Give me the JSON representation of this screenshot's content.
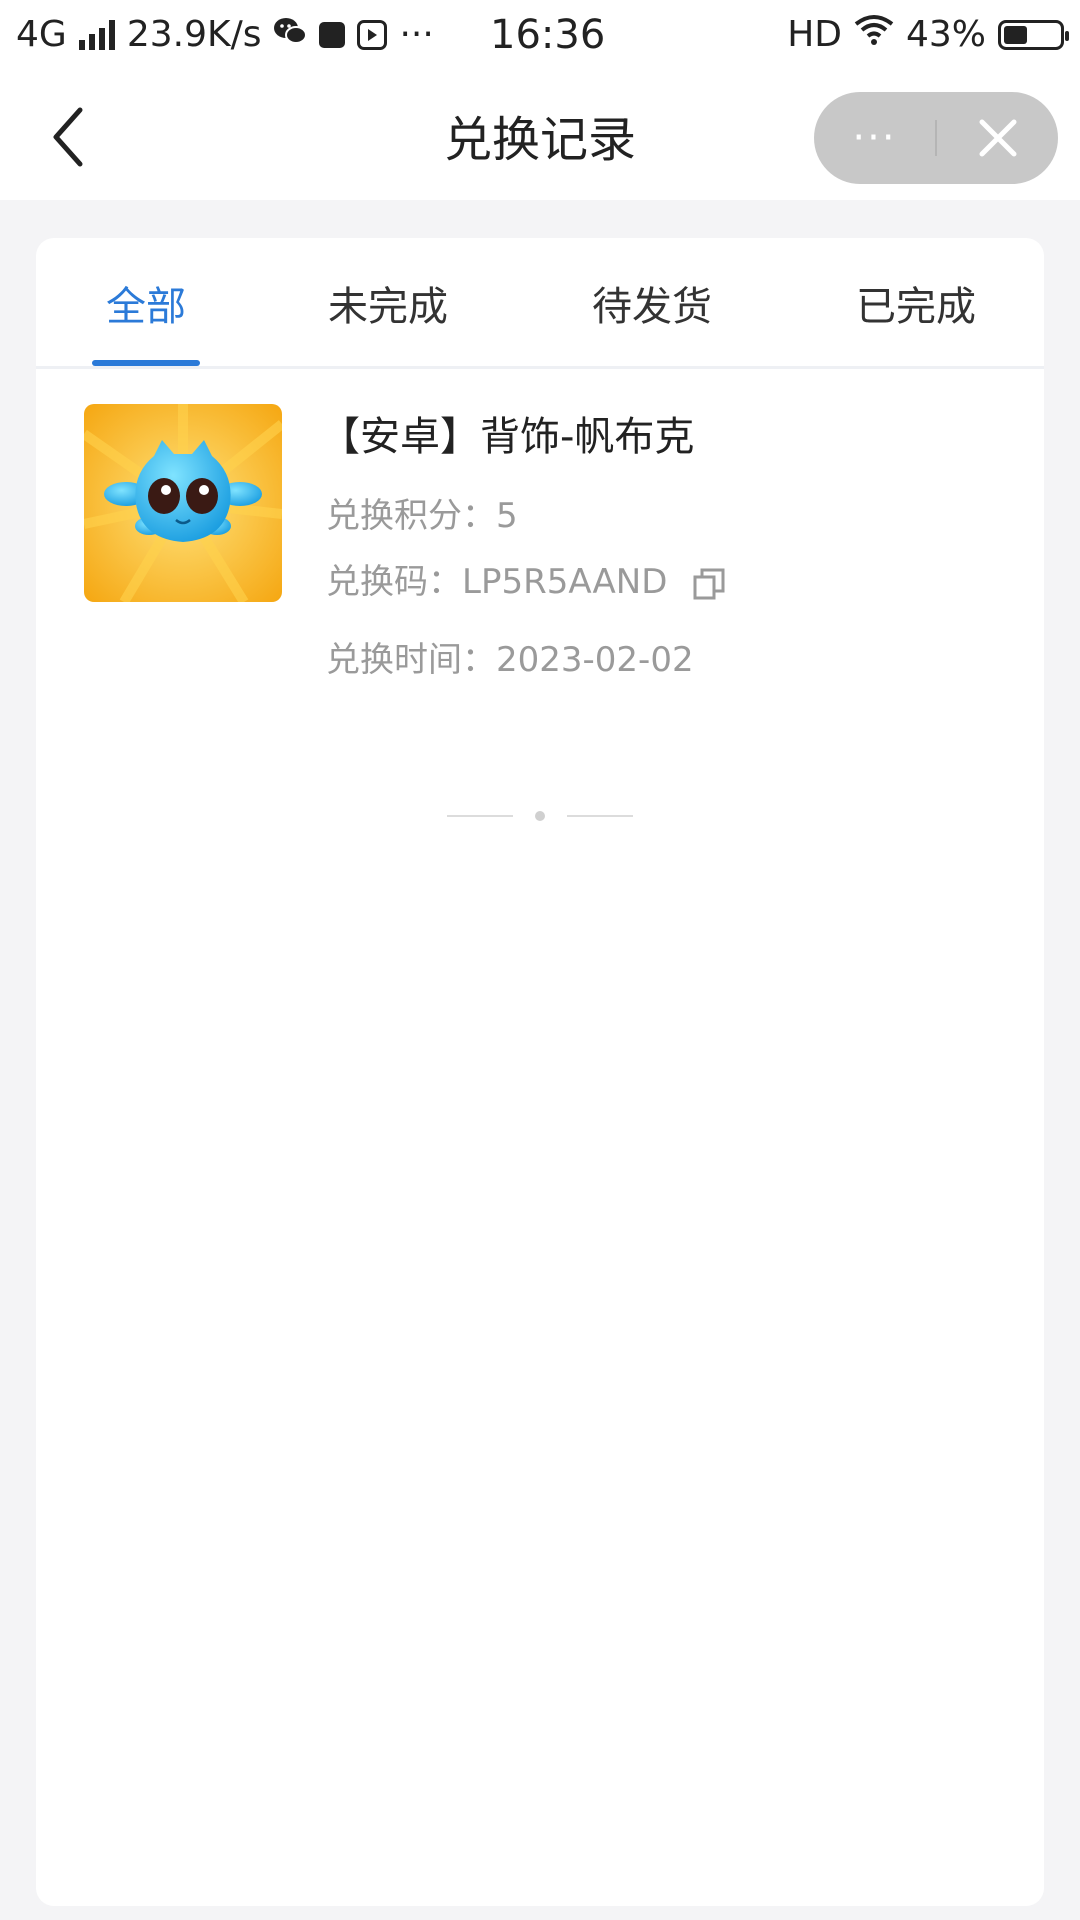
{
  "status_bar": {
    "network": "4G",
    "speed": "23.9K/s",
    "more": "···",
    "time": "16:36",
    "hd": "HD",
    "battery": "43%",
    "battery_level": 0.43
  },
  "nav": {
    "title": "兑换记录",
    "more_label": "···"
  },
  "tabs": [
    {
      "label": "全部",
      "active": true
    },
    {
      "label": "未完成",
      "active": false
    },
    {
      "label": "待发货",
      "active": false
    },
    {
      "label": "已完成",
      "active": false
    }
  ],
  "records": [
    {
      "title": "【安卓】背饰-帆布克",
      "points_label": "兑换积分：",
      "points": "5",
      "code_label": "兑换码：",
      "code": "LP5R5AAND",
      "time_label": "兑换时间：",
      "time": "2023-02-02",
      "thumbnail_icon": "blue-monster-icon"
    }
  ],
  "colors": {
    "accent": "#2b7ad8",
    "page_bg": "#f4f4f6",
    "muted_text": "#9a9a9a",
    "thumb_bg": "#f8b61c"
  }
}
